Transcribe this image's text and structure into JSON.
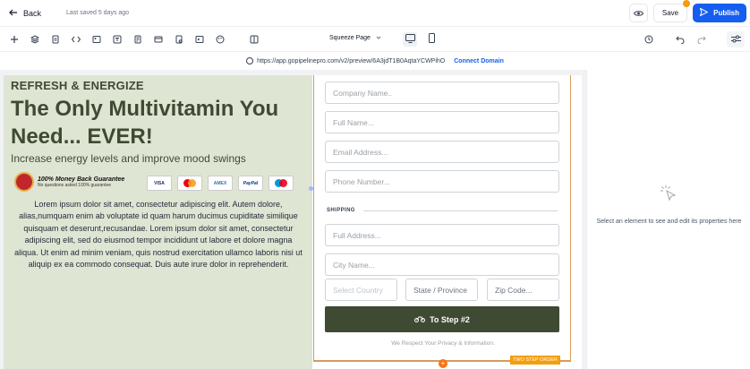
{
  "header": {
    "back_label": "Back",
    "last_saved": "Last saved 5 days ago",
    "save_label": "Save",
    "publish_label": "Publish"
  },
  "toolbar": {
    "page_name": "Squeeze Page"
  },
  "preview": {
    "url": "https://app.gopipelinepro.com/v2/preview/6A3jdT1B0AqtaYCWPihO",
    "connect_domain": "Connect Domain"
  },
  "page": {
    "kicker": "REFRESH & ENERGIZE",
    "title": "The Only Multivitamin You Need... EVER!",
    "subtitle": "Increase energy levels and improve mood swings",
    "guarantee_title": "100% Money Back Guarantee",
    "guarantee_sub": "No questions asked 100% guarantee",
    "card_visa": "VISA",
    "card_amex": "AMEX",
    "card_paypal": "PayPal",
    "body": "Lorem ipsum dolor sit amet, consectetur adipiscing elit. Autem dolore, alias,numquam enim ab voluptate id quam harum ducimus cupiditate similique quisquam et deserunt,recusandae. Lorem ipsum dolor sit amet, consectetur adipiscing elit, sed do eiusmod tempor incididunt ut labore et dolore magna aliqua. Ut enim ad minim veniam, quis nostrud exercitation ullamco laboris nisi ut aliquip ex ea commodo consequat. Duis aute irure dolor in reprehenderit."
  },
  "form": {
    "company_placeholder": "Company Name..",
    "fullname_placeholder": "Full Name...",
    "email_placeholder": "Email Address...",
    "phone_placeholder": "Phone Number...",
    "shipping_label": "SHIPPING",
    "address_placeholder": "Full Address...",
    "city_placeholder": "City Name...",
    "country_placeholder": "Select Country",
    "state_placeholder": "State / Province",
    "zip_placeholder": "Zip Code...",
    "button_label": "To Step #2",
    "privacy": "We Respect Your Privacy & Information.",
    "badge": "TWO STEP ORDER",
    "accent": "#3f4a33",
    "border": "#d89a5a"
  },
  "properties": {
    "empty_text": "Select an element to see and edit its properties here"
  },
  "colors": {
    "publish": "#155eef",
    "hero_bg": "#dfe5d3",
    "badge": "#f59e0b"
  }
}
